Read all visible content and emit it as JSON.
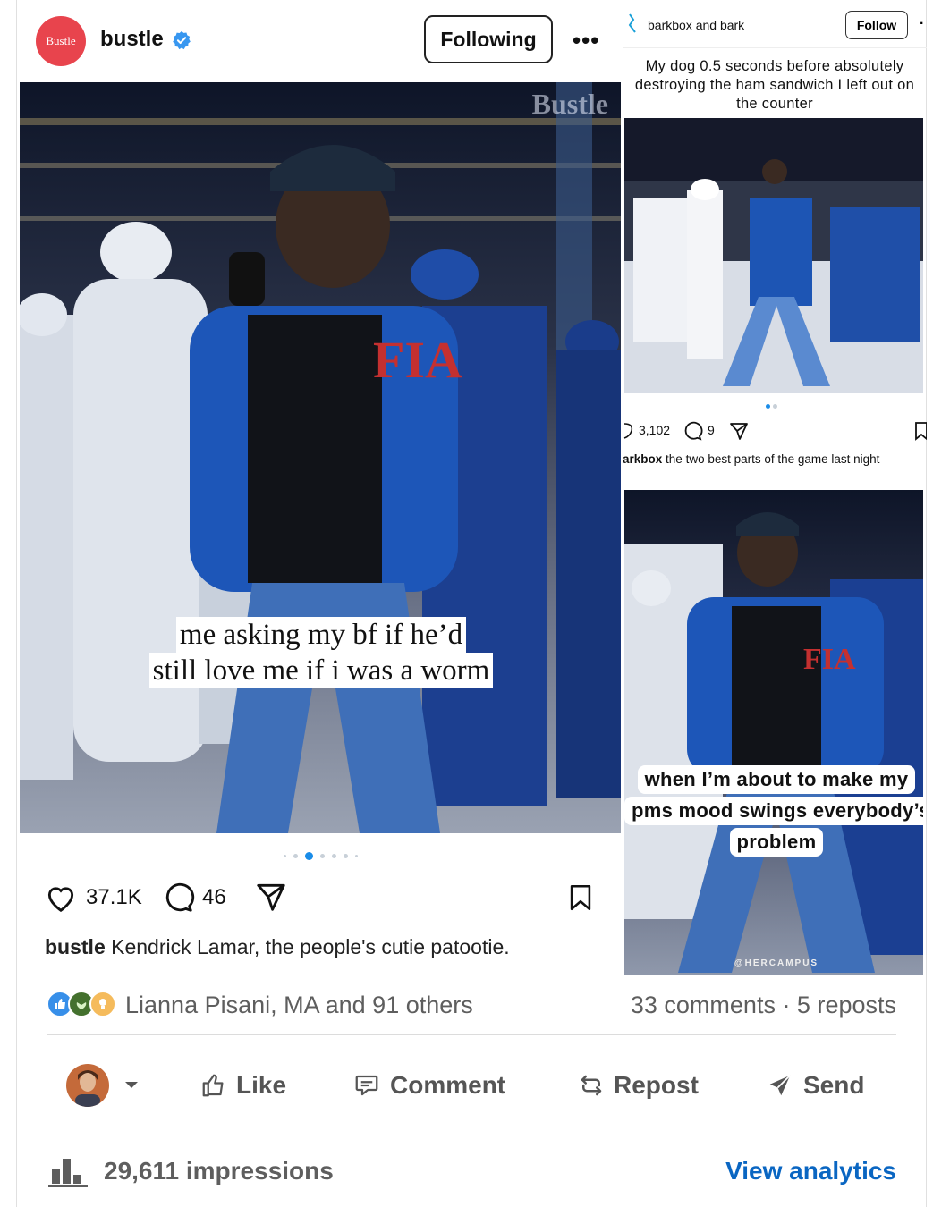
{
  "left_post": {
    "avatar_text": "Bustle",
    "username": "bustle",
    "follow_label": "Following",
    "more_label": "•••",
    "watermark": "Bustle",
    "caption_line1": "me asking my bf if he’d",
    "caption_line2": "still love me if i was a worm",
    "likes": "37.1K",
    "comments": "46",
    "caption_user": "bustle",
    "caption_text": "Kendrick Lamar, the people's cutie patootie."
  },
  "right_post": {
    "username": "barkbox and bark",
    "follow_label": "Follow",
    "title": "My dog 0.5 seconds before absolutely destroying the ham sandwich I left out on the counter",
    "likes": "3,102",
    "comments": "9",
    "caption_user": "arkbox",
    "caption_text": "the two best parts of the game last night",
    "caption2_line1": "when I’m about to make my",
    "caption2_line2": "pms mood swings everybody’s",
    "caption2_line3": "problem",
    "watermark": "@HERCAMPUS"
  },
  "linkedin": {
    "reactors": "Lianna Pisani, MA and 91 others",
    "comments_reposts": "33 comments · 5 reposts",
    "like_label": "Like",
    "comment_label": "Comment",
    "repost_label": "Repost",
    "send_label": "Send",
    "impressions": "29,611 impressions",
    "view_analytics": "View analytics"
  },
  "colors": {
    "accent_blue": "#0a66c2",
    "ig_blue": "#1a8ce8",
    "bustle_red": "#e8444d"
  }
}
